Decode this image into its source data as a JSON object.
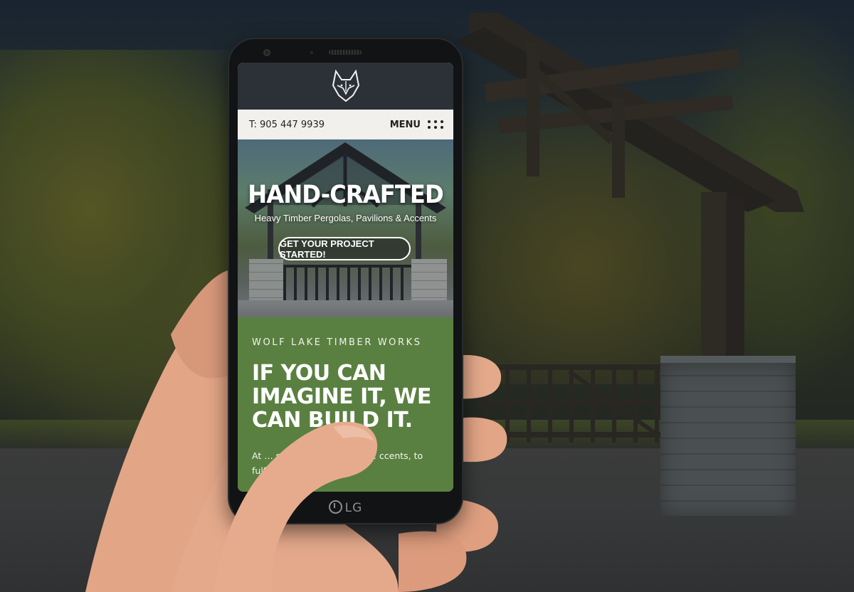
{
  "site": {
    "phone_label": "T: 905 447 9939",
    "menu_label": "MENU"
  },
  "hero": {
    "title": "HAND-CRAFTED",
    "subtitle": "Heavy Timber Pergolas, Pavilions & Accents",
    "cta_label": "GET YOUR PROJECT STARTED!"
  },
  "intro": {
    "eyebrow": "WOLF LAKE TIMBER WORKS",
    "headline": "IF YOU CAN IMAGINE IT, WE CAN BUILD IT.",
    "body_visible": "At … strive to … y timber … ccents, to fulfill your vision"
  },
  "device": {
    "brand": "LG"
  },
  "colors": {
    "header_bg": "#2c3138",
    "topbar_bg": "#f1f0ec",
    "section_green": "#5a8041",
    "phone_body": "#121314"
  },
  "icons": {
    "logo": "wolf-head-icon",
    "menu": "dot-grid-icon"
  }
}
